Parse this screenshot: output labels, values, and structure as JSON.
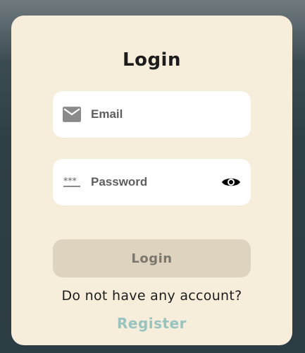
{
  "card": {
    "title": "Login",
    "email": {
      "placeholder": "Email",
      "value": "",
      "icon": "mail-icon"
    },
    "password": {
      "placeholder": "Password",
      "value": "",
      "icon": "password-dots-icon",
      "toggle_icon": "eye-icon"
    },
    "login_label": "Login",
    "no_account_text": "Do not have any account?",
    "register_label": "Register"
  },
  "colors": {
    "card_background": "#f6eedb",
    "button_disabled": "#ddd3bf",
    "register_link": "#97c3c1",
    "background_dark": "#2b3c42"
  }
}
